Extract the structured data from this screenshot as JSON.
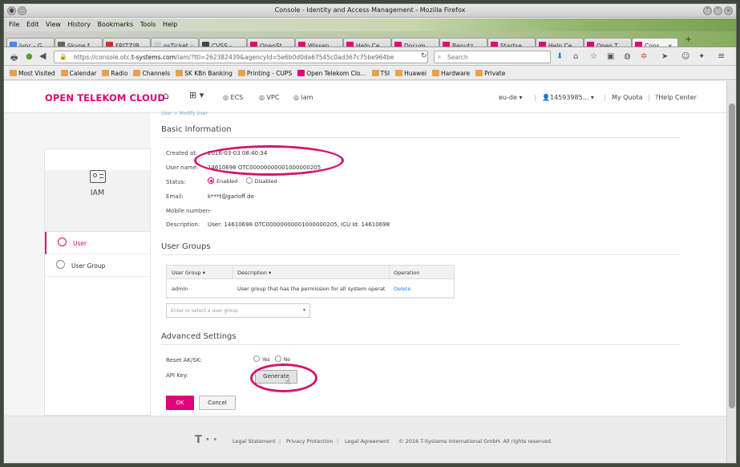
{
  "window": {
    "title": "Console - Identity and Access Management - Mozilla Firefox"
  },
  "menu": [
    "File",
    "Edit",
    "View",
    "History",
    "Bookmarks",
    "Tools",
    "Help"
  ],
  "tabs": [
    {
      "label": "lync - G...",
      "fav": "#4285f4"
    },
    {
      "label": "Skype f...",
      "fav": "#666666"
    },
    {
      "label": "FRITZ!B...",
      "fav": "#cc3333"
    },
    {
      "label": "osTicket ::",
      "fav": "#cccccc"
    },
    {
      "label": "CVSS - ...",
      "fav": "#444444"
    },
    {
      "label": "OpenSt...",
      "fav": "#e20074"
    },
    {
      "label": "Wissen ...",
      "fav": "#e20074"
    },
    {
      "label": "Help Ce...",
      "fav": "#e20074"
    },
    {
      "label": "Docum...",
      "fav": "#e20074"
    },
    {
      "label": "Benutz...",
      "fav": "#e20074"
    },
    {
      "label": "Startse...",
      "fav": "#e20074"
    },
    {
      "label": "Help Ce...",
      "fav": "#e20074"
    },
    {
      "label": "Open T...",
      "fav": "#e20074"
    },
    {
      "label": "Cons...",
      "fav": "#e20074"
    }
  ],
  "address": {
    "prefix": "https://console.otc.",
    "host": "t-systems.com",
    "rest": "/iam/?ttl=262382439&agencyId=5e6b0d0da67545c0ad367c75be964be"
  },
  "search_placeholder": "Search",
  "bookmarks": [
    {
      "label": "Most Visited",
      "t": false
    },
    {
      "label": "Calendar",
      "t": false
    },
    {
      "label": "Radio",
      "t": false
    },
    {
      "label": "Channels",
      "t": false
    },
    {
      "label": "SK KBn Banking",
      "t": false
    },
    {
      "label": "Printing - CUPS",
      "t": false
    },
    {
      "label": "Open Telekom Clo...",
      "t": true
    },
    {
      "label": "TSI",
      "t": false
    },
    {
      "label": "Huawei",
      "t": false
    },
    {
      "label": "Hardware",
      "t": false
    },
    {
      "label": "Private",
      "t": false
    }
  ],
  "topnav": {
    "brand": "OPEN TELEKOM CLOUD",
    "ecs": "ECS",
    "vpc": "VPC",
    "iam": "iam",
    "region": "eu-de",
    "user": "14593985...",
    "quota": "My Quota",
    "help": "Help Center"
  },
  "sidebar": {
    "title": "IAM",
    "items": [
      "User",
      "User Group"
    ]
  },
  "breadcrumb": "User > Modify User",
  "basic": {
    "heading": "Basic Information",
    "created_label": "Created at:",
    "created_value": "2016-03-03 08:40:34",
    "username_label": "User name:",
    "username_value": "14610698 OTC00000000001000000205",
    "status_label": "Status:",
    "enabled": "Enabled",
    "disabled": "Disabled",
    "email_label": "Email:",
    "email_value": "k***t@garloff.de",
    "mobile_label": "Mobile number:",
    "mobile_value": "--",
    "desc_label": "Description:",
    "desc_value": "User: 14610698 OTC00000000001000000205, ICU Id: 14610698"
  },
  "groups": {
    "heading": "User Groups",
    "col_group": "User Group",
    "col_desc": "Description",
    "col_op": "Operation",
    "row_group": "admin",
    "row_desc": "User group that has the permission for all system operati...",
    "row_op": "Delete",
    "select_placeholder": "Enter or select a user group."
  },
  "advanced": {
    "heading": "Advanced Settings",
    "reset_label": "Reset AK/SK:",
    "yes": "Yes",
    "no": "No",
    "api_label": "API Key:",
    "generate": "Generate"
  },
  "actions": {
    "ok": "OK",
    "cancel": "Cancel"
  },
  "footer": {
    "legal": "Legal Statement",
    "privacy": "Privacy Protection",
    "agreement": "Legal Agreement",
    "copyright": "© 2016 T-Systems International GmbH. All rights reserved."
  },
  "colors": {
    "brand_magenta": "#e20074",
    "highlight": "#d4146f",
    "link": "#1e88e5"
  }
}
